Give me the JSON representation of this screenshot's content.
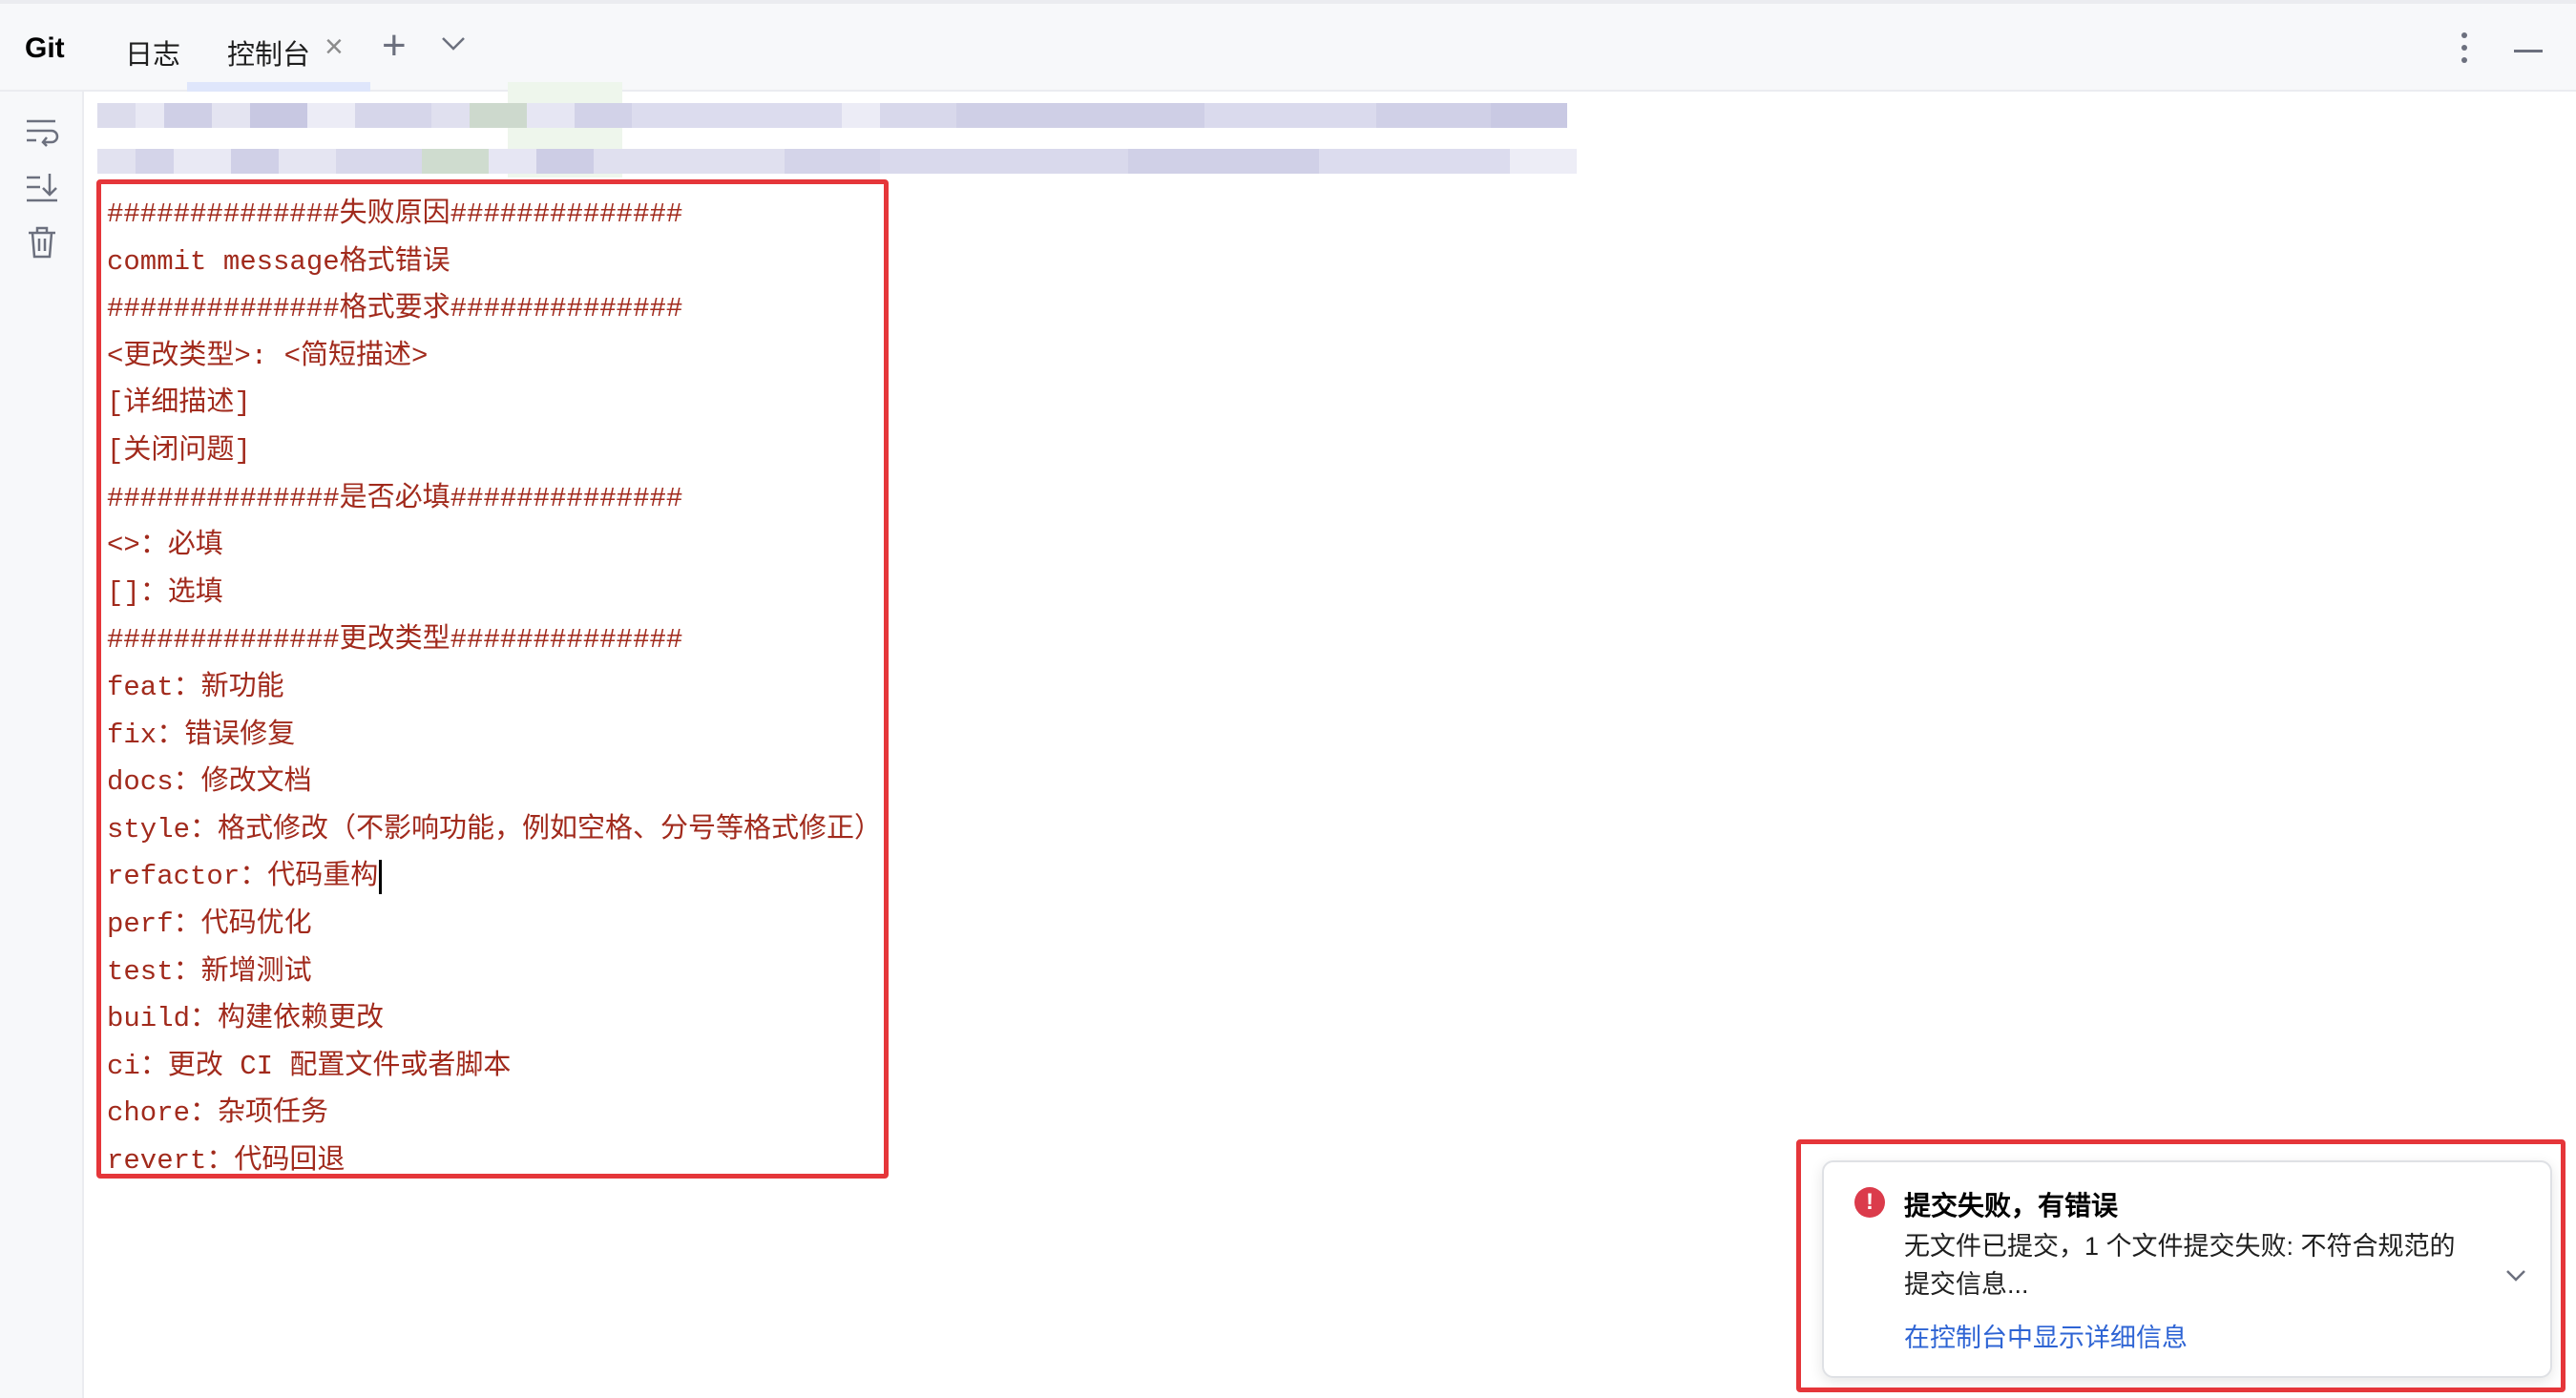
{
  "toolwindow": {
    "title": "Git",
    "tabs": [
      {
        "label": "日志"
      },
      {
        "label": "控制台"
      }
    ]
  },
  "side_toolbar": {
    "icons": [
      "soft-wrap-icon",
      "scroll-to-end-icon",
      "clear-all-icon"
    ]
  },
  "console": {
    "lines": [
      "##############失败原因##############",
      "commit message格式错误",
      "##############格式要求##############",
      "<更改类型>: <简短描述>",
      "[详细描述]",
      "[关闭问题]",
      "##############是否必填##############",
      "<>：必填",
      "[]：选填",
      "##############更改类型##############",
      "feat：新功能",
      "fix：错误修复",
      "docs：修改文档",
      "style：格式修改（不影响功能，例如空格、分号等格式修正）",
      "refactor：代码重构",
      "perf：代码优化",
      "test：新增测试",
      "build：构建依赖更改",
      "ci：更改 CI 配置文件或者脚本",
      "chore：杂项任务",
      "revert：代码回退"
    ],
    "text_color": "#a12a1c"
  },
  "notification": {
    "title": "提交失败，有错误",
    "body": "无文件已提交，1 个文件提交失败: 不符合规范的提交信息...",
    "link": "在控制台中显示详细信息",
    "icon": "error-icon",
    "icon_color": "#db3b4b",
    "link_color": "#2e64d4"
  },
  "annotation_color": "#e5363a"
}
